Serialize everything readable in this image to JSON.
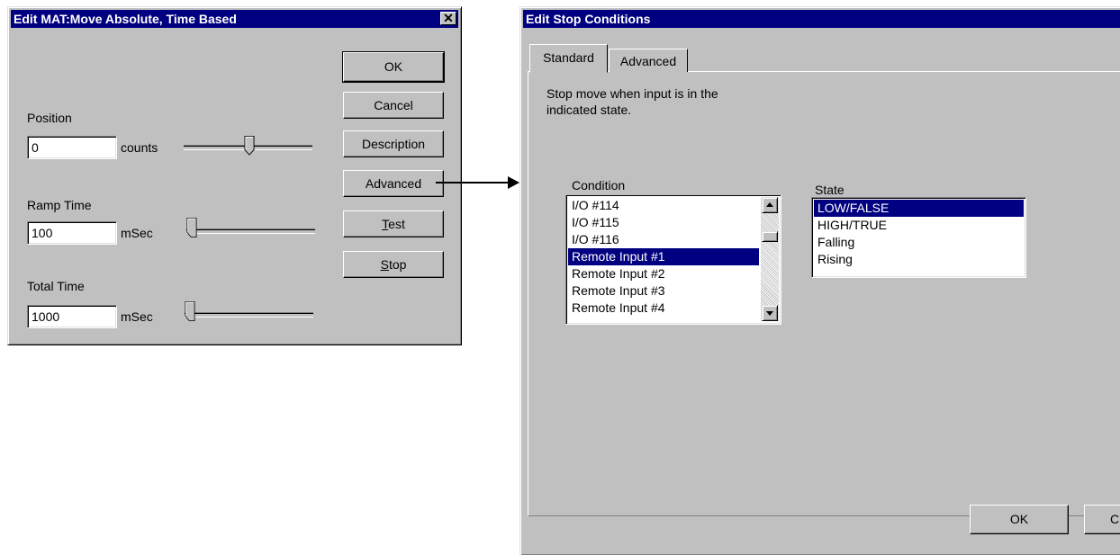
{
  "mat_dialog": {
    "title": "Edit MAT:Move Absolute, Time Based",
    "close_glyph": "✕",
    "buttons": {
      "ok": "OK",
      "cancel": "Cancel",
      "description": "Description",
      "advanced": "Advanced",
      "test": "Test",
      "stop": "Stop"
    },
    "position": {
      "label": "Position",
      "value": "0",
      "unit": "counts"
    },
    "ramp_time": {
      "label": "Ramp Time",
      "value": "100",
      "unit": "mSec"
    },
    "total_time": {
      "label": "Total Time",
      "value": "1000",
      "unit": "mSec"
    }
  },
  "stop_dialog": {
    "title": "Edit Stop Conditions",
    "tabs": [
      "Standard",
      "Advanced"
    ],
    "instruction_line1": "Stop move when input is in the",
    "instruction_line2": "indicated state.",
    "condition_label": "Condition",
    "condition_items": [
      "I/O #114",
      "I/O #115",
      "I/O #116",
      "Remote Input #1",
      "Remote Input #2",
      "Remote Input #3",
      "Remote Input #4"
    ],
    "condition_selected": "Remote Input #1",
    "state_label": "State",
    "state_items": [
      "LOW/FALSE",
      "HIGH/TRUE",
      "Falling",
      "Rising"
    ],
    "state_selected": "LOW/FALSE",
    "ok_label": "OK",
    "cancel_label_partial": "C"
  },
  "icons": {
    "scroll_up": "scroll-up-arrow-icon",
    "scroll_down": "scroll-down-arrow-icon",
    "connector": "connector-arrow-icon"
  },
  "colors": {
    "dialog_face": "#c0c0c0",
    "title_bar": "#000080",
    "selection": "#000080"
  }
}
